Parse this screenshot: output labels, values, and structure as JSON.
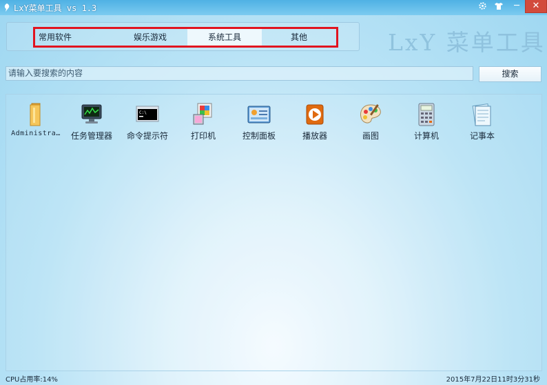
{
  "window": {
    "title": "LxY菜单工具 vs 1.3",
    "watermark": "LxY 菜单工具",
    "icons": [
      "gear-icon",
      "skin-icon",
      "minimize-icon",
      "close-icon"
    ],
    "minimize_glyph": "─",
    "close_glyph": "✕"
  },
  "tabs": [
    {
      "label": "常用软件",
      "active": false
    },
    {
      "label": "娱乐游戏",
      "active": false
    },
    {
      "label": "系统工具",
      "active": true
    },
    {
      "label": "其他",
      "active": false
    }
  ],
  "search": {
    "placeholder": "请输入要搜索的内容",
    "button_label": "搜索"
  },
  "apps": [
    {
      "label": "Administra…",
      "icon": "folder-icon"
    },
    {
      "label": "任务管理器",
      "icon": "task-manager-icon"
    },
    {
      "label": "命令提示符",
      "icon": "command-prompt-icon"
    },
    {
      "label": "打印机",
      "icon": "printer-icon"
    },
    {
      "label": "控制面板",
      "icon": "control-panel-icon"
    },
    {
      "label": "播放器",
      "icon": "media-player-icon"
    },
    {
      "label": "画图",
      "icon": "paint-palette-icon"
    },
    {
      "label": "计算机",
      "icon": "calculator-icon"
    },
    {
      "label": "记事本",
      "icon": "notepad-icon"
    }
  ],
  "status": {
    "cpu": "CPU占用率:14%",
    "datetime": "2015年7月22日11时3分31秒"
  },
  "colors": {
    "highlight_border": "#e1131f",
    "titlebar": "#4fb1e4",
    "close_button": "#d24b3c"
  }
}
